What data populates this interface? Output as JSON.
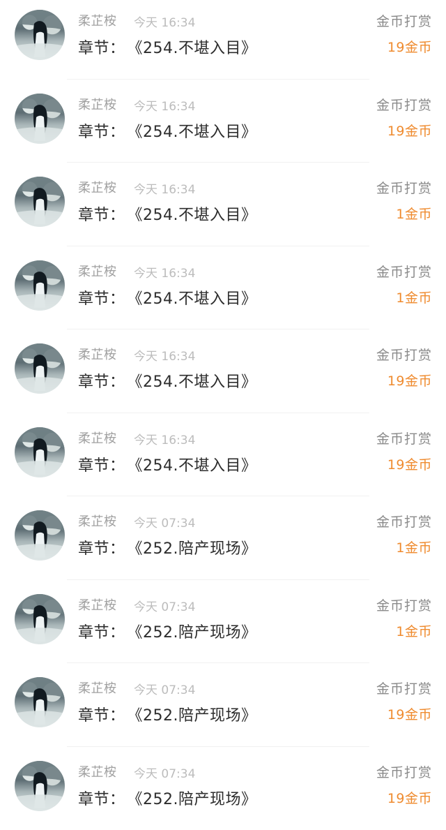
{
  "rewards": [
    {
      "user": "柔芷桉",
      "time": "今天 16:34",
      "chapter_label": "章节：",
      "chapter": "《254.不堪入目》",
      "type": "金币打赏",
      "amount": "19金币"
    },
    {
      "user": "柔芷桉",
      "time": "今天 16:34",
      "chapter_label": "章节：",
      "chapter": "《254.不堪入目》",
      "type": "金币打赏",
      "amount": "19金币"
    },
    {
      "user": "柔芷桉",
      "time": "今天 16:34",
      "chapter_label": "章节：",
      "chapter": "《254.不堪入目》",
      "type": "金币打赏",
      "amount": "1金币"
    },
    {
      "user": "柔芷桉",
      "time": "今天 16:34",
      "chapter_label": "章节：",
      "chapter": "《254.不堪入目》",
      "type": "金币打赏",
      "amount": "1金币"
    },
    {
      "user": "柔芷桉",
      "time": "今天 16:34",
      "chapter_label": "章节：",
      "chapter": "《254.不堪入目》",
      "type": "金币打赏",
      "amount": "19金币"
    },
    {
      "user": "柔芷桉",
      "time": "今天 16:34",
      "chapter_label": "章节：",
      "chapter": "《254.不堪入目》",
      "type": "金币打赏",
      "amount": "19金币"
    },
    {
      "user": "柔芷桉",
      "time": "今天 07:34",
      "chapter_label": "章节：",
      "chapter": "《252.陪产现场》",
      "type": "金币打赏",
      "amount": "1金币"
    },
    {
      "user": "柔芷桉",
      "time": "今天 07:34",
      "chapter_label": "章节：",
      "chapter": "《252.陪产现场》",
      "type": "金币打赏",
      "amount": "1金币"
    },
    {
      "user": "柔芷桉",
      "time": "今天 07:34",
      "chapter_label": "章节：",
      "chapter": "《252.陪产现场》",
      "type": "金币打赏",
      "amount": "19金币"
    },
    {
      "user": "柔芷桉",
      "time": "今天 07:34",
      "chapter_label": "章节：",
      "chapter": "《252.陪产现场》",
      "type": "金币打赏",
      "amount": "19金币"
    }
  ],
  "colors": {
    "amount": "#ef8b2f",
    "name": "#a0a0a0",
    "time": "#bcbcbc",
    "text": "#2d2d2d",
    "type": "#8a8a8a"
  }
}
